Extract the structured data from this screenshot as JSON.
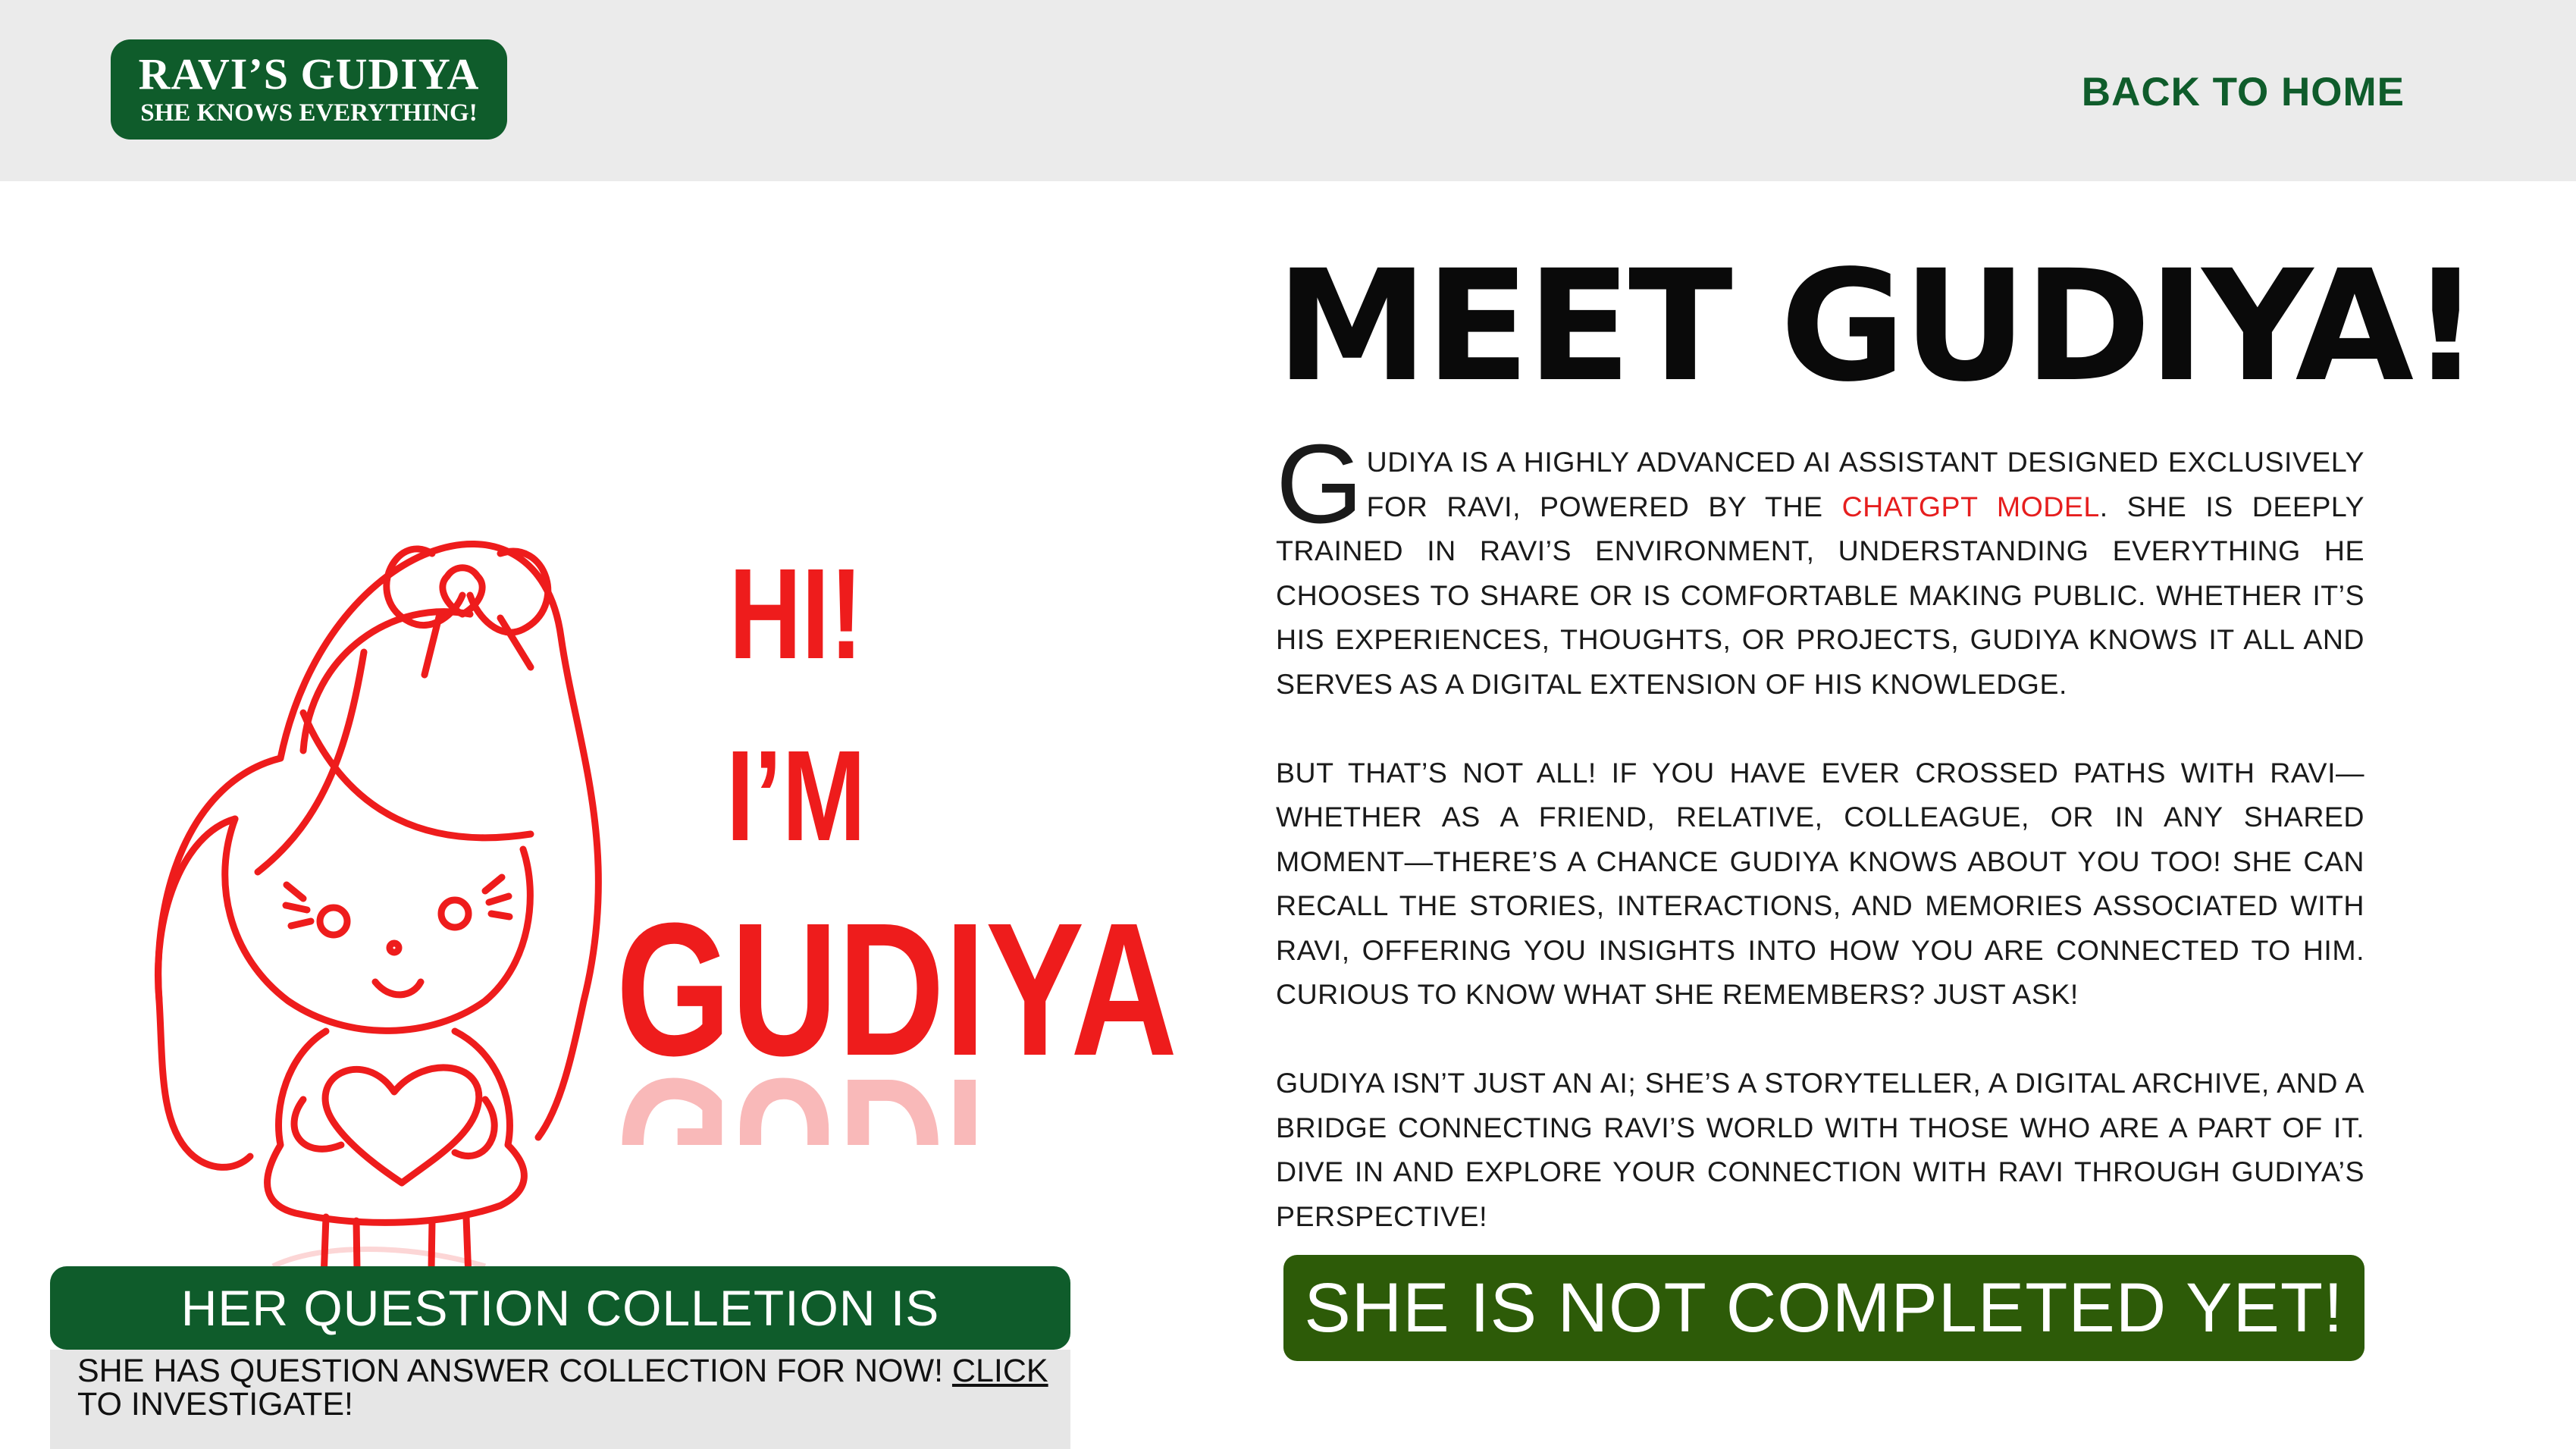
{
  "header": {
    "logo_title": "RAVI’S GUDIYA",
    "logo_tagline": "SHE KNOWS EVERYTHING!",
    "back_link": "BACK TO HOME"
  },
  "hero": {
    "line1": "HI!",
    "line2": "I’M",
    "line3": "GUDIYA",
    "reflection": "GUDIYA"
  },
  "question_collection": {
    "banner": "HER QUESTION COLLETION IS AVAILABLE",
    "note_text": "SHE HAS QUESTION ANSWER COLLECTION FOR NOW! ",
    "note_link": "CLICK",
    "note_tail": " TO INVESTIGATE!"
  },
  "main": {
    "title": "MEET GUDIYA!",
    "p1_dropcap": "G",
    "p1_a": "UDIYA IS A HIGHLY ADVANCED AI ASSISTANT DESIGNED EXCLUSIVELY FOR RAVI, POWERED BY THE ",
    "p1_link": "CHATGPT MODEL",
    "p1_b": ". SHE IS DEEPLY TRAINED IN RAVI’S ENVIRONMENT, UNDERSTANDING EVERYTHING HE CHOOSES TO SHARE OR IS COMFORTABLE MAKING PUBLIC. WHETHER IT’S HIS EXPERIENCES, THOUGHTS, OR PROJECTS, GUDIYA KNOWS IT ALL AND SERVES AS A DIGITAL EXTENSION OF HIS KNOWLEDGE.",
    "p2": "BUT THAT’S NOT ALL! IF YOU HAVE EVER CROSSED PATHS WITH RAVI—WHETHER AS A FRIEND, RELATIVE, COLLEAGUE, OR IN ANY SHARED MOMENT—THERE’S A CHANCE GUDIYA KNOWS ABOUT YOU TOO! SHE CAN RECALL THE STORIES, INTERACTIONS, AND MEMORIES ASSOCIATED WITH RAVI, OFFERING YOU INSIGHTS INTO HOW YOU ARE CONNECTED TO HIM. CURIOUS TO KNOW WHAT SHE REMEMBERS? JUST ASK!",
    "p3": "GUDIYA ISN’T JUST AN AI; SHE’S A STORYTELLER, A DIGITAL ARCHIVE, AND A BRIDGE CONNECTING RAVI’S WORLD WITH THOSE WHO ARE A PART OF IT. DIVE IN AND EXPLORE YOUR CONNECTION WITH RAVI THROUGH GUDIYA’S PERSPECTIVE!",
    "cta": "SHE IS NOT COMPLETED YET!"
  },
  "colors": {
    "brand_green": "#0f5c2b",
    "cta_green": "#2d5b08",
    "accent_red": "#ee1c1c",
    "header_bg": "#ebebeb"
  }
}
